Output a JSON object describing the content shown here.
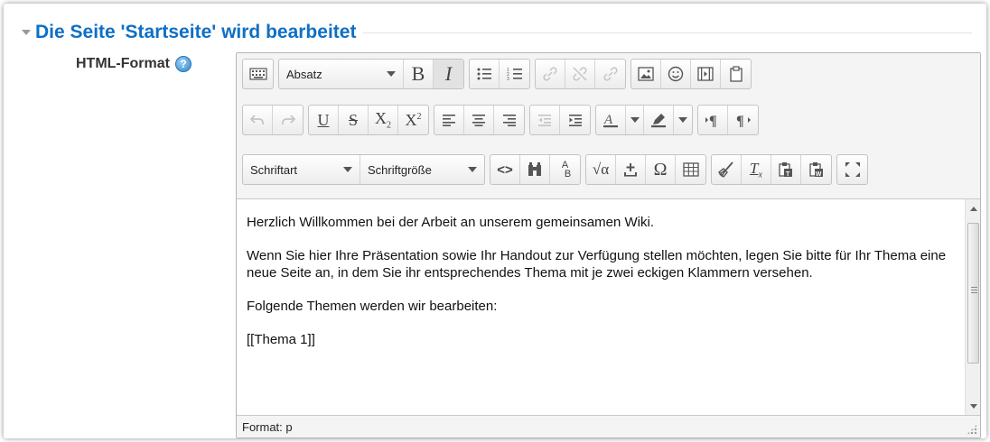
{
  "section": {
    "title": "Die Seite 'Startseite' wird bearbeitet"
  },
  "field": {
    "label": "HTML-Format",
    "help_icon": "?"
  },
  "toolbar": {
    "paragraph_format": "Absatz",
    "bold": "B",
    "italic": "I",
    "underline": "U",
    "strike": "S",
    "subscript": "X",
    "subscript_mark": "2",
    "superscript": "X",
    "superscript_mark": "2",
    "font_family": "Schriftart",
    "font_size": "Schriftgröße",
    "code": "<>",
    "special_char": "Ω",
    "clear_format": "T",
    "clear_format_mark": "x",
    "spellcheck": "A",
    "spellcheck_mark": "B",
    "equation": "√α"
  },
  "content": {
    "paragraphs": [
      "Herzlich Willkommen bei der Arbeit an unserem gemeinsamen Wiki.",
      "Wenn Sie hier Ihre Präsentation sowie Ihr Handout zur Verfügung stellen möchten, legen Sie bitte für Ihr Thema eine neue Seite an, in dem Sie ihr entsprechendes Thema mit je zwei eckigen Klammern versehen.",
      "Folgende Themen werden wir bearbeiten:",
      "[[Thema 1]]"
    ]
  },
  "status": {
    "text": "Format: p"
  },
  "colors": {
    "accent": "#0f6fc5",
    "toolbar_bg": "#f4f4f4",
    "border": "#b6b6b6"
  }
}
